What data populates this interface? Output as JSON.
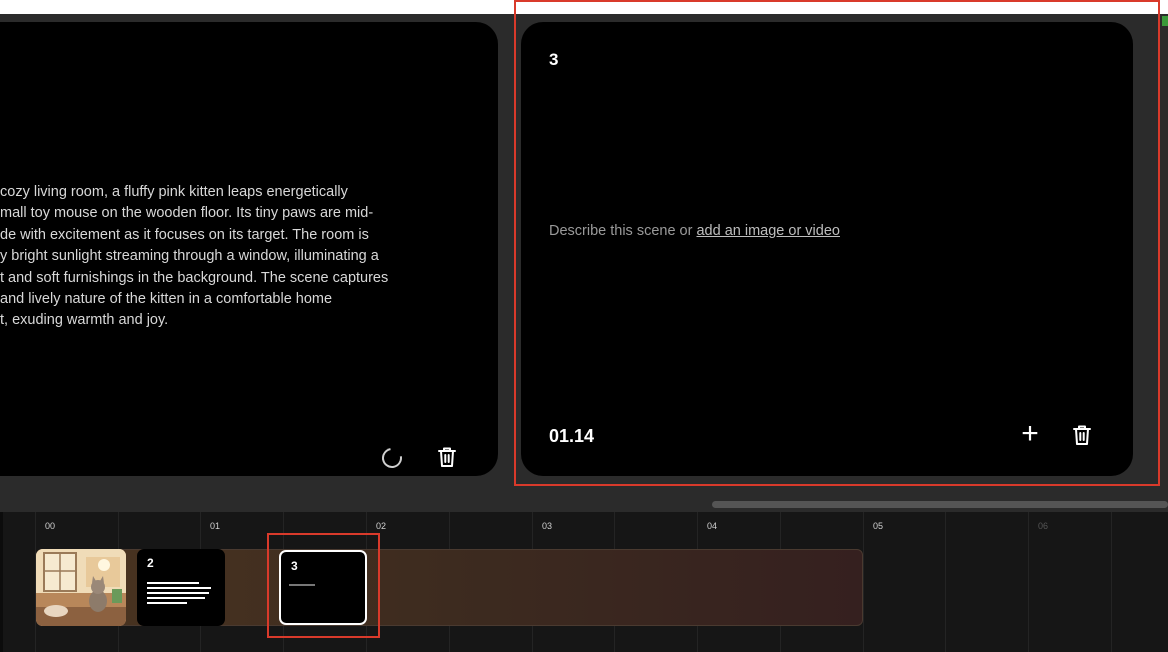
{
  "left_card": {
    "description_lines": [
      "cozy living room, a fluffy pink kitten leaps energetically",
      "mall toy mouse on the wooden floor. Its tiny paws are mid-",
      "de with excitement as it focuses on its target. The room is",
      "y bright sunlight streaming through a window, illuminating a",
      "t and soft furnishings in the background. The scene captures",
      "and lively nature of the kitten in a comfortable home",
      "t, exuding warmth and joy."
    ],
    "status_icon": "loading-spinner-icon",
    "delete_icon": "trash-icon"
  },
  "right_card": {
    "scene_number": "3",
    "placeholder_prefix": "Describe this scene or ",
    "placeholder_link": "add an image or video",
    "time": "01.14",
    "add_icon": "plus-icon",
    "add_glyph": "+",
    "delete_icon": "trash-icon"
  },
  "timeline": {
    "tick_labels": [
      "00",
      "01",
      "02",
      "03",
      "04",
      "05",
      "06"
    ],
    "scenes": [
      {
        "type": "image",
        "icon": "kitten-image-thumbnail"
      },
      {
        "number": "2",
        "type": "text"
      },
      {
        "number": "3",
        "type": "empty",
        "selected": true
      }
    ]
  },
  "colors": {
    "highlight": "#d93a2b",
    "card_bg": "#000000",
    "panel_bg": "#2b2b2b",
    "timeline_bg": "#161616"
  }
}
